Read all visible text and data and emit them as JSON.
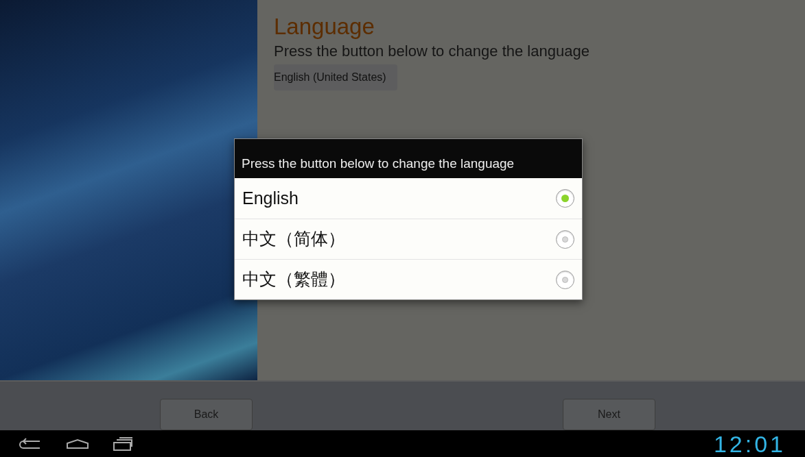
{
  "page": {
    "title": "Language",
    "instruction": "Press the button below to change the language",
    "current_language": "English (United States)"
  },
  "dialog": {
    "title": "Press the button below to change the language",
    "options": [
      {
        "label": "English",
        "selected": true
      },
      {
        "label": "中文（简体）",
        "selected": false
      },
      {
        "label": "中文（繁體）",
        "selected": false
      }
    ]
  },
  "buttons": [
    {
      "label": "Back"
    },
    {
      "label": "Next"
    }
  ],
  "navigation_bar": {
    "time": "12:01"
  }
}
